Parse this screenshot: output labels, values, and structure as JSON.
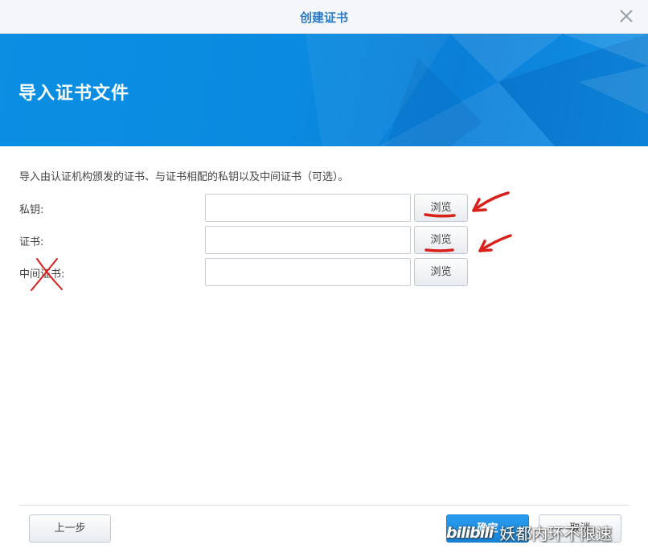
{
  "dialog": {
    "title": "创建证书",
    "heading": "导入证书文件",
    "description": "导入由认证机构颁发的证书、与证书相配的私钥以及中间证书（可选）。"
  },
  "fields": [
    {
      "label": "私钥:",
      "value": "",
      "browse_label": "浏览"
    },
    {
      "label": "证书:",
      "value": "",
      "browse_label": "浏览"
    },
    {
      "label": "中间证书:",
      "value": "",
      "browse_label": "浏览"
    }
  ],
  "footer": {
    "prev_label": "上一步",
    "ok_label": "确定",
    "cancel_label": "取消"
  },
  "watermark": {
    "logo": "bilibili",
    "text": "妖都内环不限速"
  },
  "colors": {
    "accent": "#2a7cc7",
    "banner": "#0a8ae0",
    "annotation": "#d9201a"
  },
  "icons": {
    "close": "close-icon"
  }
}
